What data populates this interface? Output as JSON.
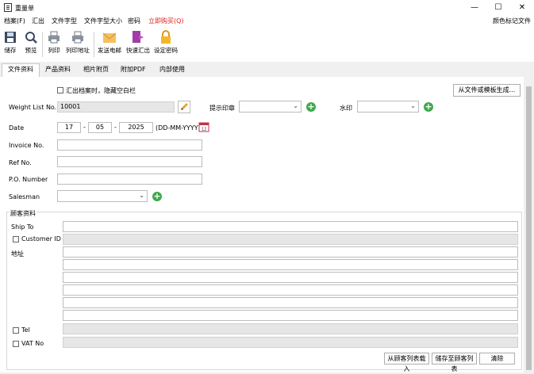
{
  "window": {
    "title": "重量单",
    "minimize": "—",
    "maximize": "☐",
    "close": "✕"
  },
  "menu": {
    "items": [
      "档案(F)",
      "汇出",
      "文件字型",
      "文件字型大小",
      "密码"
    ],
    "purchase": "立即购买(Q)",
    "right": "颜色标记文件"
  },
  "toolbar": {
    "save": "储存",
    "preview": "预览",
    "print": "列印",
    "print_address": "列印地址",
    "send_email": "发送电邮",
    "quick_export": "快速汇出",
    "set_password": "设定密码"
  },
  "tabs": [
    "文件资料",
    "产品资料",
    "相片附页",
    "附加PDF",
    "内部使用"
  ],
  "form": {
    "hide_blank_label": "汇出档案时，隐藏空白栏",
    "from_file_button": "从文件或模板生成...",
    "weight_list_label": "Weight List No.",
    "weight_list_value": "10001",
    "stamp_label": "提示印章",
    "watermark_label": "水印",
    "date_label": "Date",
    "date_day": "17",
    "date_month": "05",
    "date_year": "2025",
    "date_sep": "-",
    "date_format": "(DD-MM-YYYY)",
    "invoice_label": "Invoice No.",
    "ref_label": "Ref No.",
    "po_label": "P.O. Number",
    "salesman_label": "Salesman"
  },
  "customer": {
    "group_title": "顾客资料",
    "ship_to": "Ship To",
    "customer_id": "Customer ID",
    "address": "地址",
    "tel": "Tel",
    "vat": "VAT No",
    "load_button": "从顾客列表载入",
    "save_button": "储存至顾客列表",
    "clear_button": "清除"
  },
  "colors": {
    "plus": "#3daa4a",
    "edit": "#f0a030",
    "calendar": "#c0364a",
    "purchase": "#e02020"
  }
}
